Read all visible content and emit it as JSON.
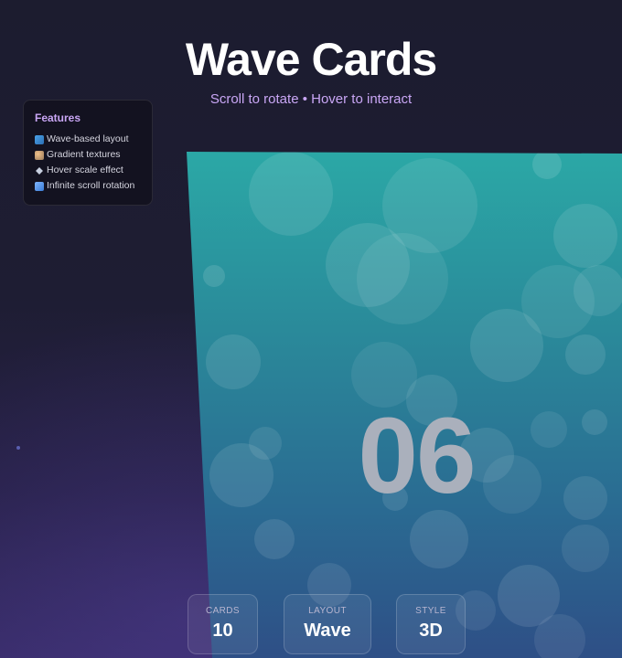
{
  "header": {
    "title": "Wave Cards",
    "subtitle": "Scroll to rotate • Hover to interact"
  },
  "features": {
    "heading": "Features",
    "items": [
      {
        "icon": "wave-icon",
        "label": "Wave-based layout"
      },
      {
        "icon": "palette-icon",
        "label": "Gradient textures"
      },
      {
        "icon": "sparkle-icon",
        "label": "Hover scale effect"
      },
      {
        "icon": "rotate-icon",
        "label": "Infinite scroll rotation"
      }
    ]
  },
  "card": {
    "number": "06",
    "gradient_top": "#2aa3a6",
    "gradient_bottom": "#2b5a8c"
  },
  "stats": [
    {
      "label": "CARDS",
      "value": "10"
    },
    {
      "label": "LAYOUT",
      "value": "Wave"
    },
    {
      "label": "STYLE",
      "value": "3D"
    }
  ],
  "colors": {
    "accent": "#c9a6f5",
    "background": "#1c1c2f"
  }
}
